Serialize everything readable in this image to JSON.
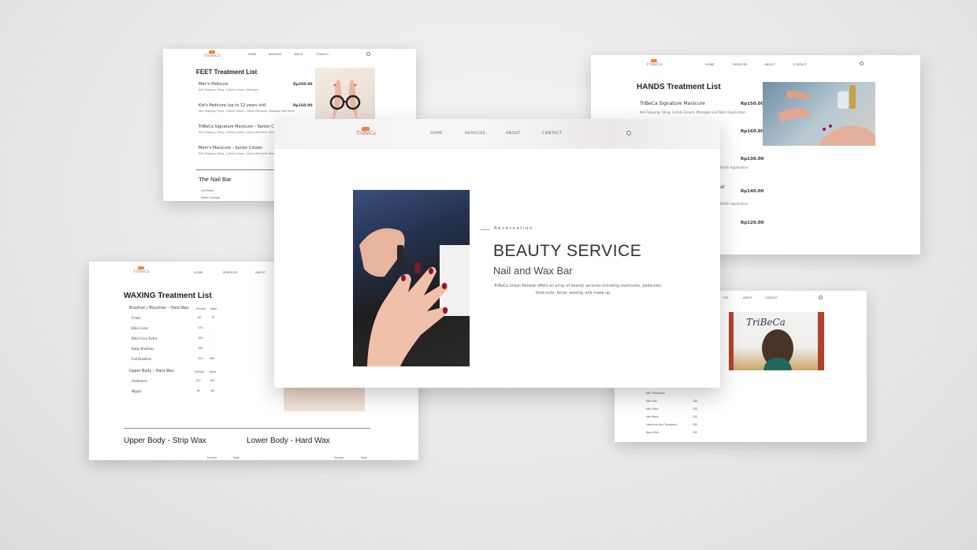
{
  "brand": {
    "logo": "TriBeCa"
  },
  "nav": {
    "home": "HOME",
    "services": "SERVICES",
    "about": "ABOUT",
    "contact": "CONTACT"
  },
  "feet": {
    "title": "FEET Treatment List",
    "items": [
      {
        "name": "Men's Pedicure",
        "desc": "Nail Shaping, Filing, Cuticle Groom, Massage",
        "price": "Rp200.00"
      },
      {
        "name": "Kid's Pedicure (up to 12 years old)",
        "desc": "Nail Shaping, Filing, Cuticle Groom, Callus Removal, Massage and Polish",
        "price": "Rp160.00"
      },
      {
        "name": "TriBeCa Signature Manicure – Senior Citizen",
        "desc": "Nail Shaping, Filing, Cuticle Groom, Callus Removal, Massage and Polish"
      },
      {
        "name": "Mom's Manicure – Senior Citizen",
        "desc": "Nail Shaping, Filing, Cuticle Groom, Callus Removal, Massage"
      }
    ],
    "nail_bar": "The Nail Bar",
    "nail_bar_rows": [
      "Gel Polish",
      "Polish Change"
    ]
  },
  "hands": {
    "title": "HANDS Treatment List",
    "items": [
      {
        "name": "TriBeCa Signature Manicure",
        "desc": "Nail Shaping, Filing, Cuticle Groom, Massage and Polish Application",
        "price": "Rp150.00"
      },
      {
        "price": "Rp160.00"
      },
      {
        "desc": "Polish Application",
        "price": "Rp130.00"
      },
      {
        "name": "ar",
        "desc": "Polish Application",
        "price": "Rp140.00"
      },
      {
        "price": "Rp120.00"
      }
    ]
  },
  "hero": {
    "eyebrow": "Reservation",
    "title": "BEAUTY SERVICE",
    "subtitle": "Nail and Wax Bar",
    "body_line1": "TriBeCa Urban Retreat offers an array of beauty services including manicures, pedicures,",
    "body_line2": "blow-outs, facial, waxing, and make-up."
  },
  "waxing": {
    "title": "WAXING Treatment List",
    "group1": {
      "name": "Brazilian / Boyzilian – Hard Wax",
      "col_female": "Female",
      "col_male": "Male",
      "rows": [
        {
          "name": "Crack",
          "female": "60",
          "male": "70"
        },
        {
          "name": "Bikini Line",
          "female": "150",
          "male": "–"
        },
        {
          "name": "Bikini Line Extra",
          "female": "180",
          "male": "–"
        },
        {
          "name": "Baby Brazilian",
          "female": "280",
          "male": "–"
        },
        {
          "name": "Full Brazilian",
          "female": "320",
          "male": "380"
        }
      ]
    },
    "group2": {
      "name": "Upper Body – Hard Wax",
      "col_female": "Female",
      "col_male": "Male",
      "rows": [
        {
          "name": "Underarm",
          "female": "120",
          "male": "140"
        },
        {
          "name": "Nipple",
          "female": "65",
          "male": "80"
        }
      ]
    },
    "section_upper": "Upper Body - Strip Wax",
    "section_lower": "Lower Body - Hard Wax",
    "col_female": "Female",
    "col_male": "Male"
  },
  "hair": {
    "salon_sign": "TriBeCa",
    "rows": [
      {
        "name": "Hair Treatment",
        "price": ""
      },
      {
        "name": "Hair Spa",
        "price": "180"
      },
      {
        "name": "Hair Spa+",
        "price": "250"
      },
      {
        "name": "Hair Mask",
        "price": "200"
      },
      {
        "name": "Intensive Hair Treatment",
        "price": "300"
      },
      {
        "name": "Nano Mist",
        "price": "300"
      }
    ]
  }
}
